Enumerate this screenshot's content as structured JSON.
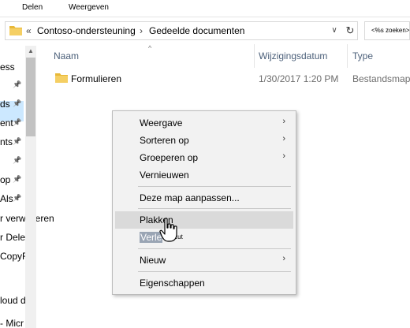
{
  "ribbon": {
    "tabs": [
      "Delen",
      "Weergeven"
    ]
  },
  "address": {
    "overflow": "«",
    "crumbs": [
      "Contoso-ondersteuning",
      "Gedeelde documenten"
    ],
    "separator": "›"
  },
  "search": {
    "placeholder": "<%s zoeken>"
  },
  "nav": {
    "items": [
      {
        "label": "ess",
        "pinned": false
      },
      {
        "label": "",
        "pinned": true
      },
      {
        "label": "ds",
        "pinned": true
      },
      {
        "label": "ent",
        "pinned": true
      },
      {
        "label": "nts",
        "pinned": true
      },
      {
        "label": "",
        "pinned": true
      },
      {
        "label": "op",
        "pinned": true
      },
      {
        "label": "Als",
        "pinned": true
      },
      {
        "label": "r verwijderen",
        "pinned": false
      },
      {
        "label": "r Dele",
        "pinned": false
      },
      {
        "label": "CopyF",
        "pinned": false
      },
      {
        "label": "loud die",
        "pinned": false
      },
      {
        "label": "- Micr",
        "pinned": false
      }
    ]
  },
  "columns": {
    "name": "Naam",
    "modified": "Wijzigingsdatum",
    "type": "Type"
  },
  "rows": [
    {
      "name": "Formulieren",
      "modified": "1/30/2017 1:20 PM",
      "type": "Bestandsmap"
    }
  ],
  "context_menu": {
    "items": [
      {
        "label": "Weergave",
        "submenu": true
      },
      {
        "label": "Sorteren op",
        "submenu": true
      },
      {
        "label": "Groeperen op",
        "submenu": true
      },
      {
        "label": "Vernieuwen",
        "submenu": false
      },
      {
        "label": "Deze map aanpassen...",
        "submenu": false
      },
      {
        "label": "Plakken",
        "submenu": false,
        "hovered": true
      },
      {
        "label": "Verle",
        "submenu": false,
        "tooltip": "ik recut"
      },
      {
        "label": "Nieuw",
        "submenu": true
      },
      {
        "label": "Eigenschappen",
        "submenu": false
      }
    ]
  },
  "colors": {
    "folder": "#f0c75e",
    "selection": "#cce8ff",
    "menu_bg": "#f2f2f2",
    "column_header_text": "#4c607a"
  }
}
